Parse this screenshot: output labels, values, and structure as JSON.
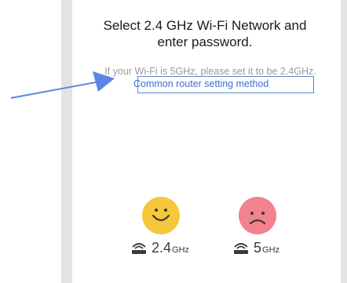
{
  "header": {
    "title_line1": "Select 2.4 GHz Wi-Fi Network and",
    "title_line2": "enter password."
  },
  "hint": {
    "text": "If your Wi-Fi is 5GHz, please set it to be 2.4GHz.",
    "link_label": "Common router setting method"
  },
  "bands": [
    {
      "face": "happy-face-icon",
      "icon": "wifi-router-icon",
      "value": "2.4",
      "unit": "GHz",
      "color": "#f6c73b",
      "status": "supported"
    },
    {
      "face": "sad-face-icon",
      "icon": "wifi-router-icon",
      "value": "5",
      "unit": "GHz",
      "color": "#f2828b",
      "status": "not supported"
    }
  ],
  "colors": {
    "link": "#3f6fd0",
    "highlight_box": "#5a86d9",
    "annotation_arrow": "#5b86e5",
    "rail": "#e3e3e5"
  }
}
